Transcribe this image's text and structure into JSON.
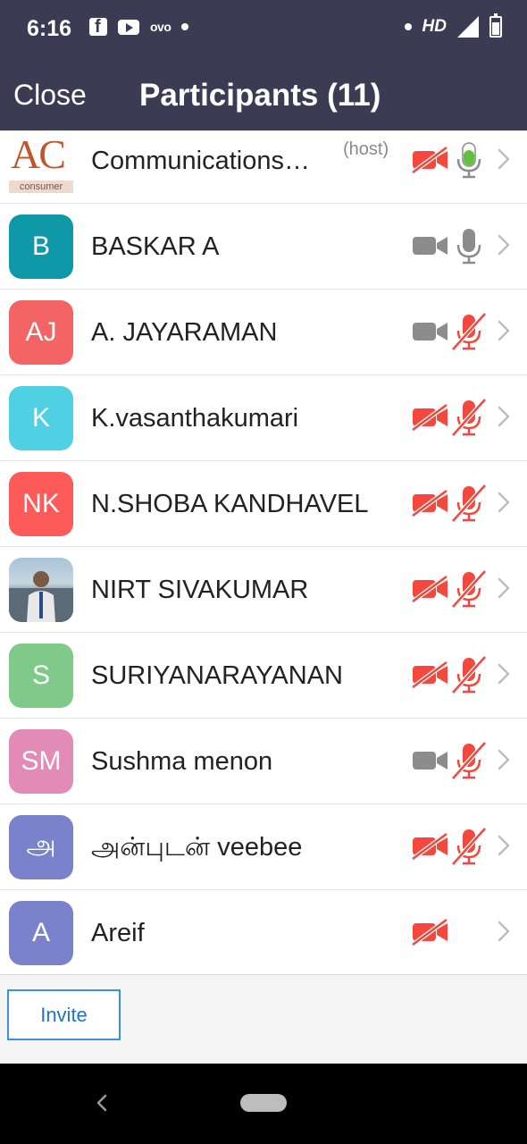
{
  "status_bar": {
    "time": "6:16",
    "left_icons": [
      "facebook-icon",
      "youtube-icon",
      "oyo-icon",
      "dot-icon"
    ],
    "oyo_text": "ovo",
    "hd_text": "HD",
    "right_icons": [
      "dot-icon",
      "signal-icon",
      "battery-icon"
    ]
  },
  "header": {
    "close_label": "Close",
    "title": "Participants (11)",
    "background": "#3b3b53"
  },
  "participants": [
    {
      "name": "Communications…",
      "avatar_text": "",
      "avatar_logo_text": "AC",
      "avatar_logo_subtext": "consumer",
      "host": "(host)",
      "video": "off",
      "audio": "on-active"
    },
    {
      "name": "BASKAR A",
      "avatar_text": "B",
      "avatar_color": "#0f98a8",
      "video": "on",
      "audio": "on"
    },
    {
      "name": "A. JAYARAMAN",
      "avatar_text": "AJ",
      "avatar_color": "#f36464",
      "video": "on",
      "audio": "muted"
    },
    {
      "name": "K.vasanthakumari",
      "avatar_text": "K",
      "avatar_color": "#4fd0e3",
      "video": "off",
      "audio": "muted"
    },
    {
      "name": "N.SHOBA KANDHAVEL",
      "avatar_text": "NK",
      "avatar_color": "#fd5a5a",
      "video": "off",
      "audio": "muted"
    },
    {
      "name": "NIRT SIVAKUMAR",
      "avatar_text": "",
      "avatar_photo": true,
      "video": "off",
      "audio": "muted"
    },
    {
      "name": "SURIYANARAYANAN",
      "avatar_text": "S",
      "avatar_color": "#7fca88",
      "video": "off",
      "audio": "muted"
    },
    {
      "name": "Sushma menon",
      "avatar_text": "SM",
      "avatar_color": "#e38bb7",
      "video": "on",
      "audio": "muted"
    },
    {
      "name": "அன்புடன் veebee",
      "avatar_text": "அ",
      "avatar_color": "#7a82cc",
      "video": "off",
      "audio": "muted"
    },
    {
      "name": "Areif",
      "avatar_text": "A",
      "avatar_color": "#7a82cc",
      "video": "off",
      "audio": "none"
    }
  ],
  "colors": {
    "muted_red": "#f2483d",
    "active_green": "#62c23f",
    "icon_gray": "#8c8c8c",
    "accent_blue": "#1f70d6"
  },
  "footer": {
    "invite_label": "Invite"
  }
}
